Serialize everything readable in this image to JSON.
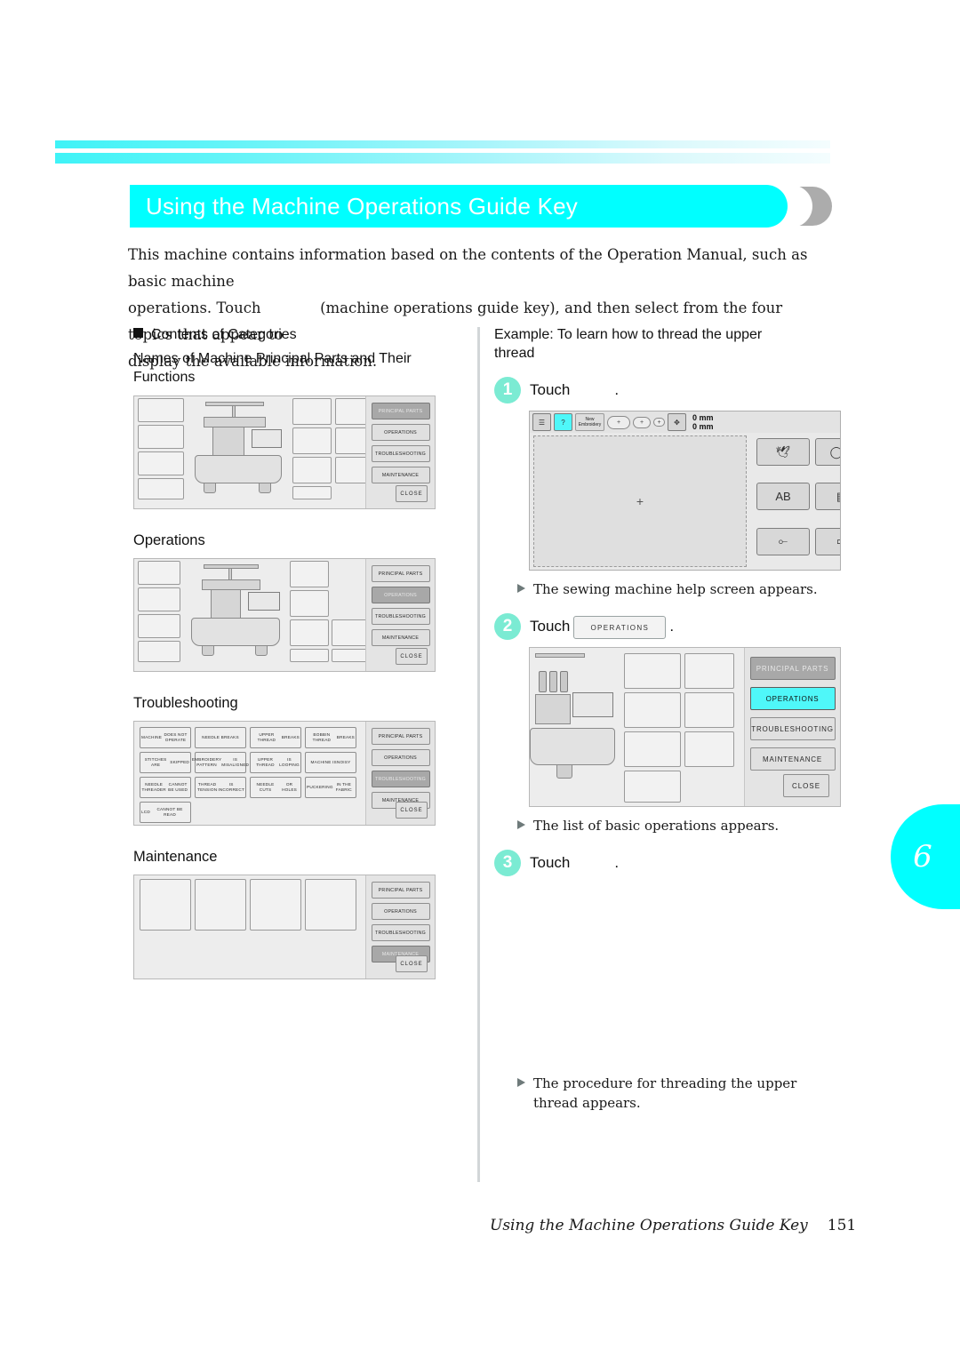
{
  "header": {
    "title": "Using the Machine Operations Guide Key",
    "accent_color": "#00FFFF"
  },
  "intro": {
    "line1": "This machine contains information based on the contents of the Operation Manual, such as basic machine",
    "line2a": "operations. Touch",
    "line2b": "(machine operations guide key), and then select from the four topics that appear to",
    "line3": "display the available information."
  },
  "left_column": {
    "contents_heading": "Contents of Categories",
    "sections": [
      {
        "title_line1": "Names of Machine Principal Parts and Their",
        "title_line2": "Functions"
      },
      {
        "title_line1": "Operations"
      },
      {
        "title_line1": "Troubleshooting"
      },
      {
        "title_line1": "Maintenance"
      }
    ],
    "category_buttons": [
      "PRINCIPAL PARTS",
      "OPERATIONS",
      "TROUBLESHOOTING",
      "MAINTENANCE"
    ],
    "close_label": "CLOSE",
    "troubleshooting_items": [
      "MACHINE\nDOES NOT OPERATE",
      "NEEDLE BREAKS",
      "UPPER THREAD\nBREAKS",
      "BOBBIN THREAD\nBREAKS",
      "STITCHES ARE\nSKIPPED",
      "EMBROIDERY PATTERN\nIS MISALIGNED",
      "UPPER THREAD\nIS LOOPING",
      "MACHINE IS\nNOISY",
      "NEEDLE THREADER\nCANNOT BE USED",
      "THREAD TENSION\nIS INCORRECT",
      "NEEDLE CUTS\nOR HOLES",
      "PUCKERING\nIN THE FABRIC",
      "LCD\nCANNOT BE READ"
    ]
  },
  "right_column": {
    "example_line1": "Example: To learn how to thread the upper",
    "example_line2": "thread",
    "steps": [
      {
        "number": "1",
        "label": "Touch",
        "key_label": "",
        "period": "."
      },
      {
        "number": "2",
        "label": "Touch",
        "key_label": "OPERATIONS",
        "period": "."
      },
      {
        "number": "3",
        "label": "Touch",
        "key_label": "",
        "period": "."
      }
    ],
    "results": [
      "The sewing machine help screen appears.",
      "The list of basic operations appears.",
      {
        "l1": "The procedure for threading the upper",
        "l2": "thread appears."
      }
    ],
    "lcd": {
      "new_label": "New\nEmbroidery",
      "dim1": "0 mm",
      "dim2": "0 mm",
      "center_mark": "+"
    }
  },
  "chapter_tab": {
    "number": "6"
  },
  "footer": {
    "title": "Using the Machine Operations Guide Key",
    "page": "151"
  }
}
